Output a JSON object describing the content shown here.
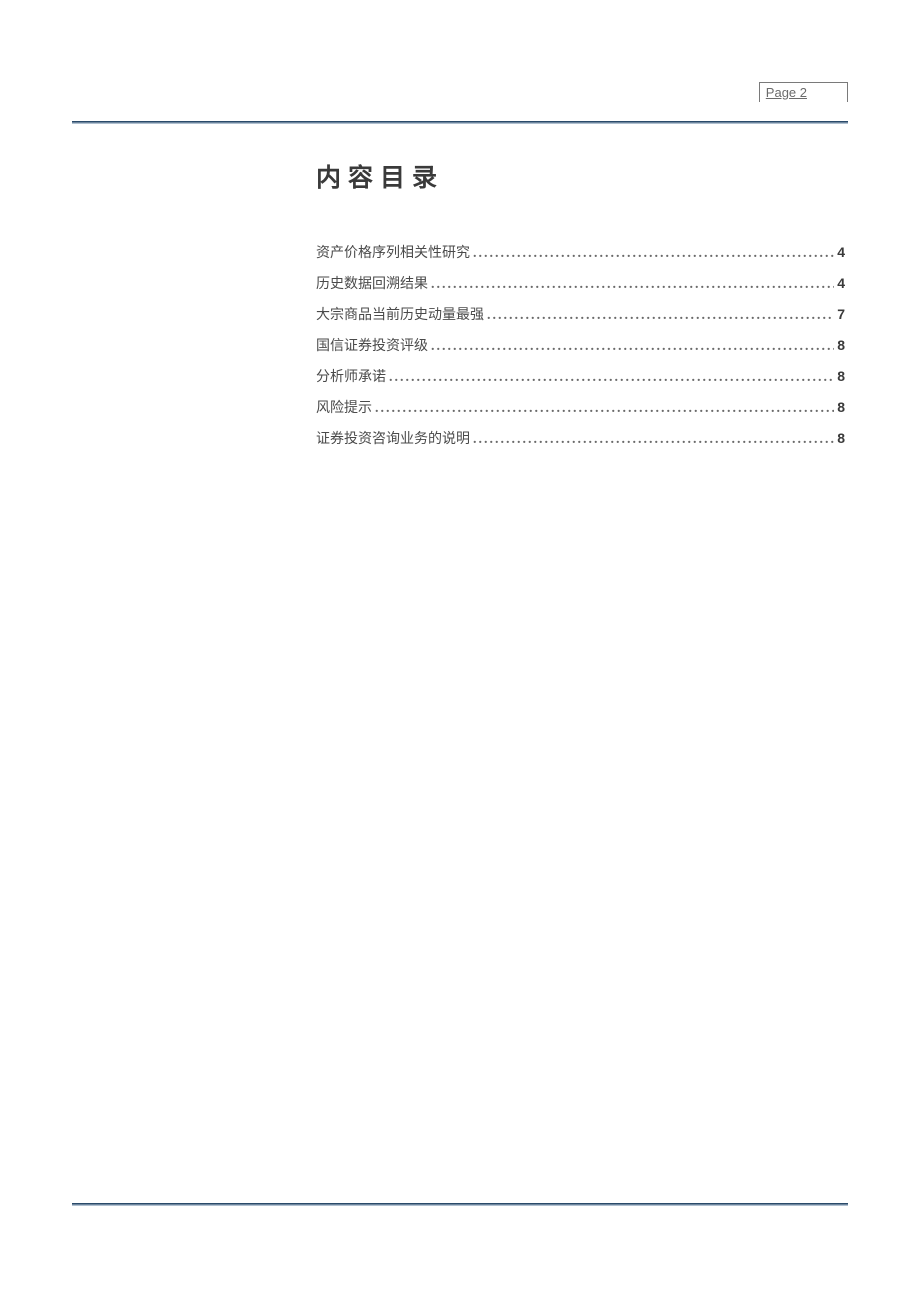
{
  "pageLabel": "Page  2",
  "title": "内容目录",
  "toc": [
    {
      "label": "资产价格序列相关性研究",
      "page": "4"
    },
    {
      "label": "历史数据回溯结果",
      "page": "4"
    },
    {
      "label": "大宗商品当前历史动量最强",
      "page": "7"
    },
    {
      "label": "国信证券投资评级",
      "page": "8"
    },
    {
      "label": "分析师承诺",
      "page": "8"
    },
    {
      "label": "风险提示",
      "page": "8"
    },
    {
      "label": "证券投资咨询业务的说明",
      "page": "8"
    }
  ]
}
